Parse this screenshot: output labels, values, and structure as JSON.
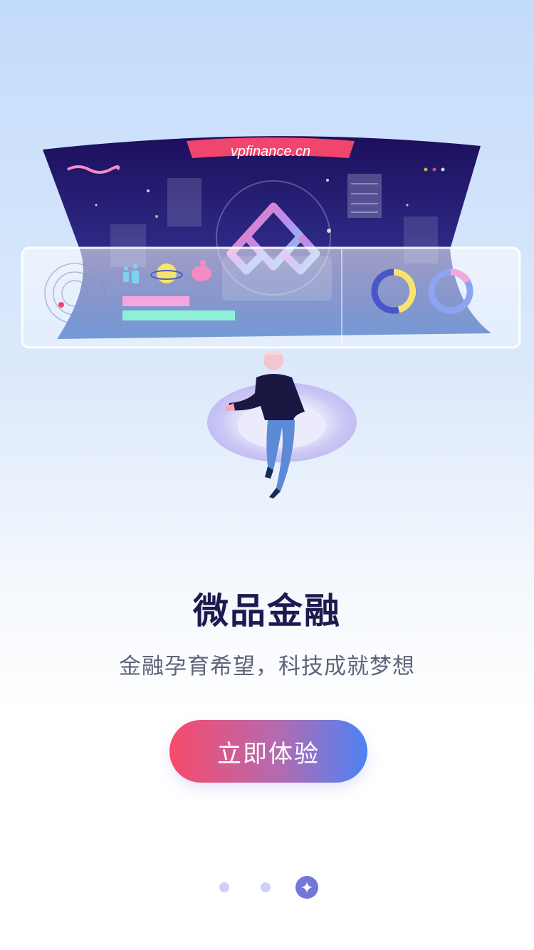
{
  "hero": {
    "banner_text": "vpfinance.cn"
  },
  "app": {
    "title": "微品金融",
    "slogan": "金融孕育希望，科技成就梦想"
  },
  "cta": {
    "label": "立即体验"
  },
  "pagination": {
    "total": 3,
    "active_index": 2
  },
  "colors": {
    "title": "#1c1a4f",
    "cta_gradient_start": "#f84a6a",
    "cta_gradient_end": "#4e82f6",
    "dot_inactive": "#cfd0f5",
    "dot_active": "#7377d8"
  }
}
